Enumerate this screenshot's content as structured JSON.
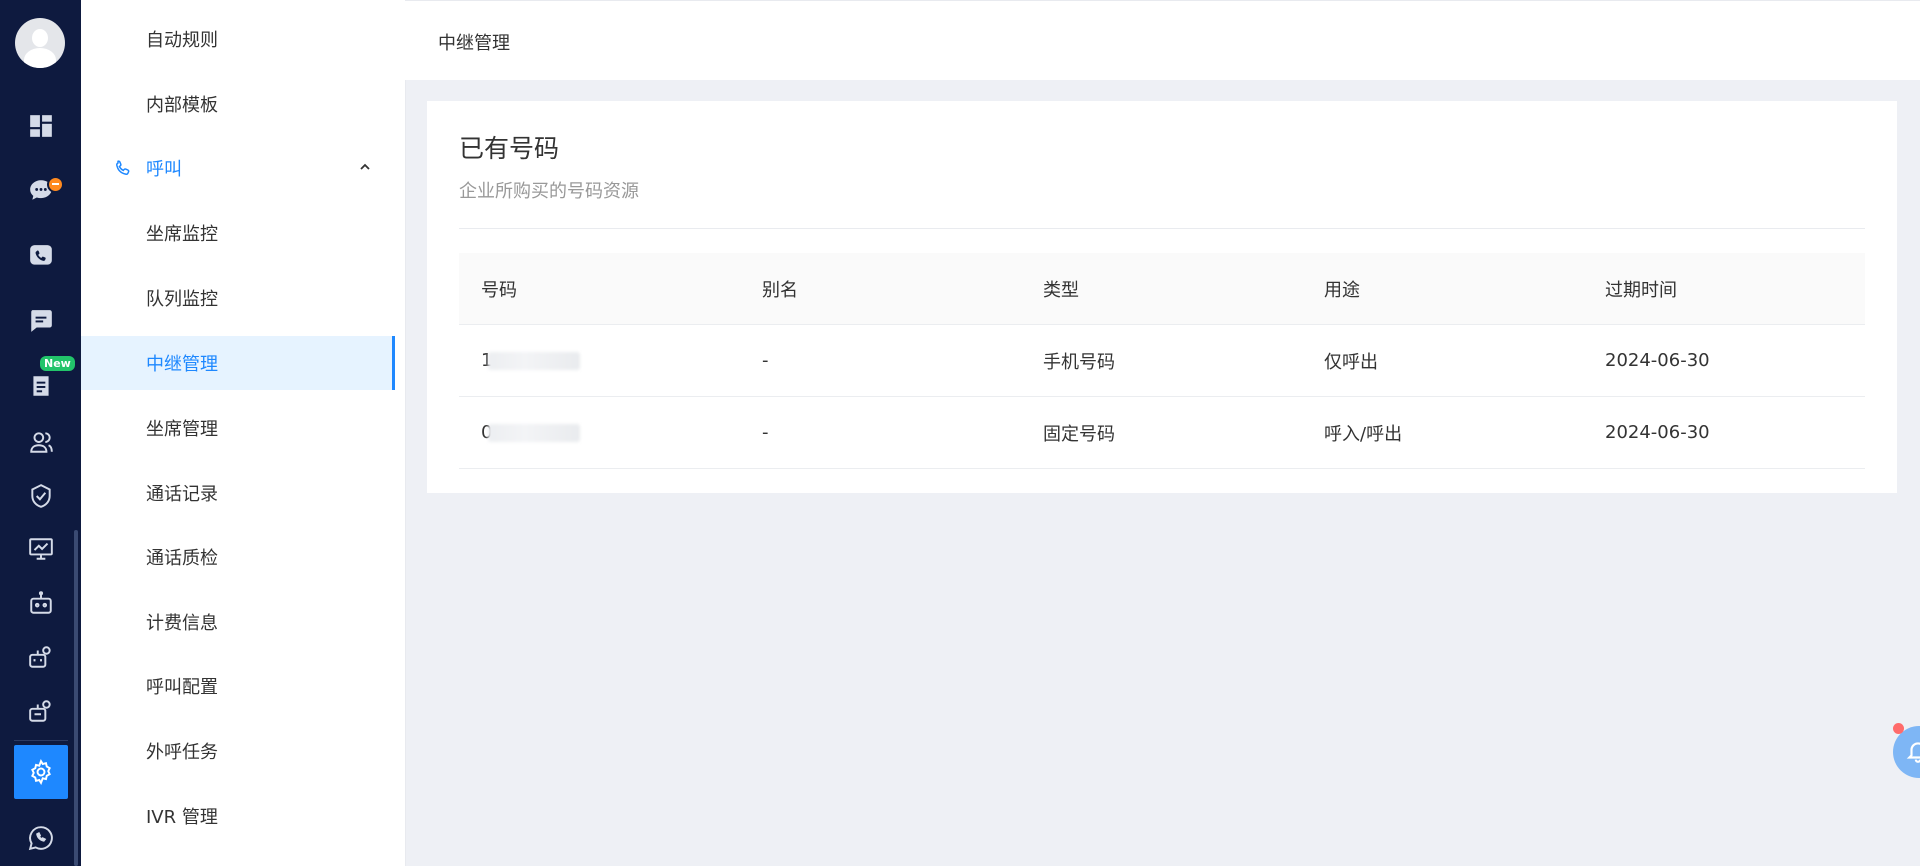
{
  "header": {
    "title": "中继管理"
  },
  "sidebar": {
    "rail_icons": [
      "dashboard-icon",
      "chat-icon",
      "phone-icon",
      "message-icon",
      "ticket-icon",
      "contacts-icon",
      "shield-icon",
      "monitor-chart-icon",
      "robot-icon",
      "bot-team-icon",
      "bot-settings-icon",
      "gear-icon",
      "whatsapp-icon"
    ],
    "new_badge": "New",
    "items": [
      {
        "label": "自动规则"
      },
      {
        "label": "内部模板"
      },
      {
        "label": "呼叫"
      },
      {
        "label": "坐席监控"
      },
      {
        "label": "队列监控"
      },
      {
        "label": "中继管理"
      },
      {
        "label": "坐席管理"
      },
      {
        "label": "通话记录"
      },
      {
        "label": "通话质检"
      },
      {
        "label": "计费信息"
      },
      {
        "label": "呼叫配置"
      },
      {
        "label": "外呼任务"
      },
      {
        "label": "IVR 管理"
      }
    ]
  },
  "card": {
    "title": "已有号码",
    "subtitle": "企业所购买的号码资源",
    "columns": [
      "号码",
      "别名",
      "类型",
      "用途",
      "过期时间"
    ],
    "rows": [
      {
        "number_prefix": "1",
        "alias": "-",
        "type": "手机号码",
        "usage": "仅呼出",
        "expire": "2024-06-30"
      },
      {
        "number_prefix": "0",
        "alias": "-",
        "type": "固定号码",
        "usage": "呼入/呼出",
        "expire": "2024-06-30"
      }
    ]
  },
  "colors": {
    "accent": "#1e88ff",
    "rail_bg": "#0e1a3f",
    "new_badge": "#22c46a",
    "notice_dot": "#ff8a1f"
  }
}
